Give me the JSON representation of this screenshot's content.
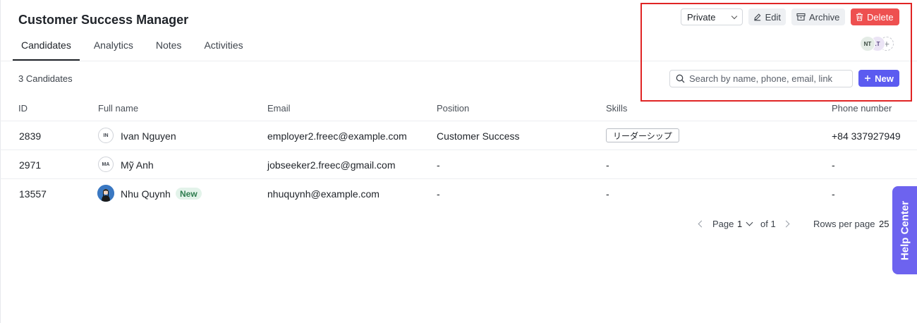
{
  "header": {
    "title": "Customer Success Manager"
  },
  "tabs": [
    {
      "label": "Candidates"
    },
    {
      "label": "Analytics"
    },
    {
      "label": "Notes"
    },
    {
      "label": "Activities"
    }
  ],
  "toolbar": {
    "visibility_value": "Private",
    "edit_label": "Edit",
    "archive_label": "Archive",
    "delete_label": "Delete",
    "new_label": "New",
    "search_placeholder": "Search by name, phone, email, link",
    "members": [
      "NT",
      ".T"
    ],
    "add_member_glyph": "+"
  },
  "colors": {
    "accent": "#5b5bf0",
    "danger": "#ee5050",
    "highlight_box": "#e02424"
  },
  "candidates_count": "3 Candidates",
  "table": {
    "columns": [
      "ID",
      "Full name",
      "Email",
      "Position",
      "Skills",
      "Phone number"
    ],
    "rows": [
      {
        "id": "2839",
        "initials": "IN",
        "name": "Ivan Nguyen",
        "email": "employer2.freec@example.com",
        "position": "Customer Success",
        "skill": "リーダーシップ",
        "phone": "+84 337927949"
      },
      {
        "id": "2971",
        "initials": "MA",
        "name": "Mỹ Anh",
        "email": "jobseeker2.freec@gmail.com",
        "position": "-",
        "skill": "-",
        "phone": "-"
      },
      {
        "id": "13557",
        "initials": "",
        "name": "Nhu Quynh",
        "badge": "New",
        "email": "nhuquynh@example.com",
        "position": "-",
        "skill": "-",
        "phone": "-"
      }
    ]
  },
  "pagination": {
    "page_label": "Page",
    "page": "1",
    "of_label": "of 1",
    "rows_label": "Rows per page",
    "rows": "25"
  },
  "help_label": "Help Center"
}
